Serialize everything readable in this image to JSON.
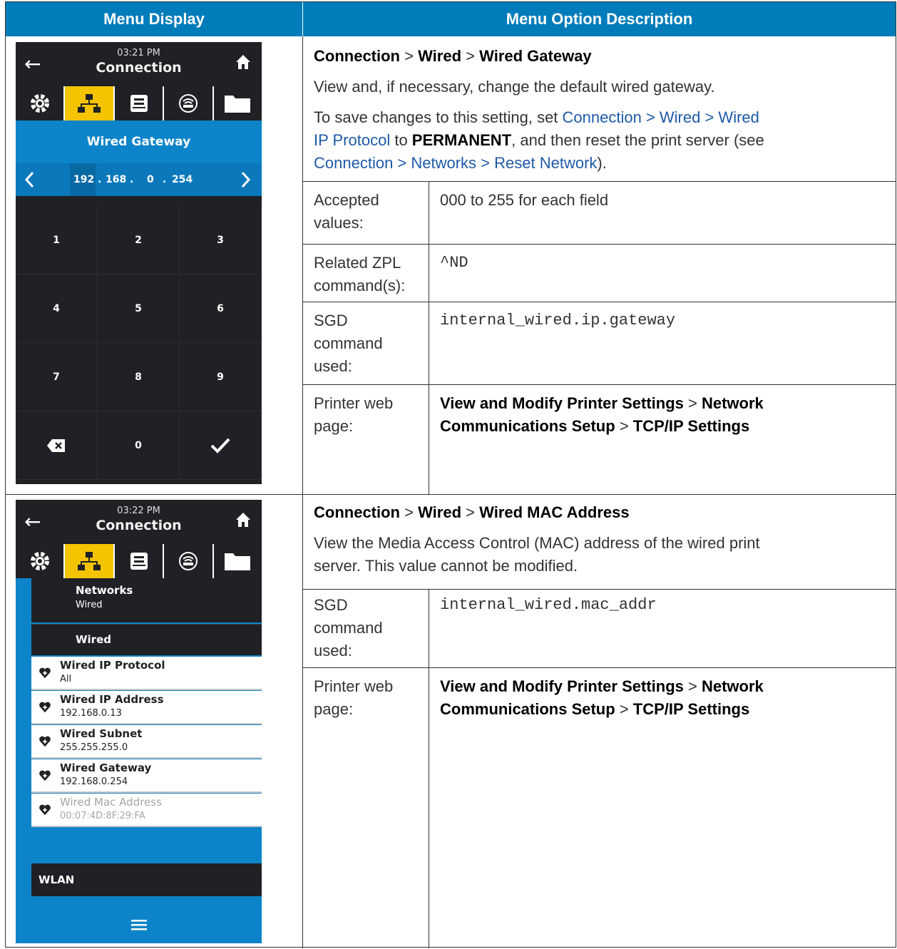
{
  "header": {
    "col1": "Menu Display",
    "col2": "Menu Option Description"
  },
  "screen1": {
    "time": "03:21 PM",
    "title": "Connection",
    "setting_title": "Wired Gateway",
    "ip_octets": [
      "192",
      "168",
      "0",
      "254"
    ],
    "keys": [
      "1",
      "2",
      "3",
      "4",
      "5",
      "6",
      "7",
      "8",
      "9",
      "0"
    ]
  },
  "section1": {
    "path": {
      "p1": "Connection",
      "sep": ">",
      "p2": "Wired",
      "p3": "Wired Gateway"
    },
    "desc": "View and, if necessary, change the default wired gateway.",
    "save_note": {
      "t1": "To save changes to this setting, set ",
      "link1a": "Connection > Wired > Wired",
      "link1b": "IP Protocol",
      "t2": " to ",
      "bold": "PERMANENT",
      "t3": ", and then reset the print server (see",
      "link2": "Connection > Networks > Reset Network",
      "t4": ")."
    },
    "rows": [
      {
        "label1": "Accepted",
        "label2": "values:",
        "value": "000 to 255 for each field"
      },
      {
        "label1": "Related ZPL",
        "label2": "command(s):",
        "value": "^ND"
      },
      {
        "label1": "SGD",
        "label2": "command",
        "label3": "used:",
        "value": "internal_wired.ip.gateway"
      },
      {
        "label1": "Printer web",
        "label2": "page:",
        "v1": "View and Modify Printer Settings",
        "sep": ">",
        "v2": "Network",
        "v3": "Communications Setup",
        "v4": "TCP/IP Settings"
      }
    ]
  },
  "screen2": {
    "time": "03:22 PM",
    "title": "Connection",
    "networks_title": "Networks",
    "networks_sub": "Wired",
    "wired_header": "Wired",
    "items": [
      {
        "title": "Wired IP Protocol",
        "value": "All"
      },
      {
        "title": "Wired IP Address",
        "value": "192.168.0.13"
      },
      {
        "title": "Wired Subnet",
        "value": "255.255.255.0"
      },
      {
        "title": "Wired Gateway",
        "value": "192.168.0.254"
      },
      {
        "title": "Wired Mac Address",
        "value": "00:07:4D:8F:29:FA"
      }
    ],
    "wlan_header": "WLAN"
  },
  "section2": {
    "path": {
      "p1": "Connection",
      "sep": ">",
      "p2": "Wired",
      "p3": "Wired MAC Address"
    },
    "desc1": "View the Media Access Control (MAC) address of the wired print",
    "desc2": "server. This value cannot be modified.",
    "rows": [
      {
        "label1": "SGD",
        "label2": "command",
        "label3": "used:",
        "value": "internal_wired.mac_addr"
      },
      {
        "label1": "Printer web",
        "label2": "page:",
        "v1": "View and Modify Printer Settings",
        "sep": ">",
        "v2": "Network",
        "v3": "Communications Setup",
        "v4": "TCP/IP Settings"
      }
    ]
  },
  "colors": {
    "header_blue": "#007cba",
    "screen_blue": "#0d84c9",
    "tab_yellow": "#f5c400",
    "link_blue": "#1e5aa8"
  },
  "icons": [
    "back-arrow-icon",
    "home-icon",
    "gear-icon",
    "network-icon",
    "printer-icon",
    "wireless-icon",
    "folder-icon",
    "chevron-left-icon",
    "chevron-right-icon",
    "backspace-icon",
    "checkmark-icon",
    "heart-plus-icon",
    "menu-icon"
  ]
}
